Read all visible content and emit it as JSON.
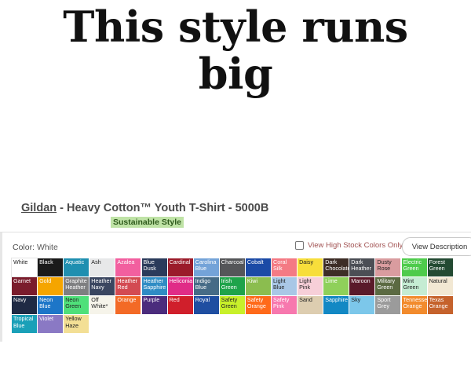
{
  "headline": {
    "line1": "This style runs",
    "line2": "big"
  },
  "product": {
    "brand": "Gildan",
    "separator": " - ",
    "title": "Heavy Cotton™ Youth T-Shirt - 5000B",
    "badge": "Sustainable Style"
  },
  "color_selector": {
    "label": "Color:",
    "selected": "White",
    "high_stock_label": "View High Stock Colors Only",
    "high_stock_checked": false,
    "view_description": "View Description"
  },
  "swatches": [
    [
      {
        "name": "White",
        "bg": "#ffffff",
        "fg": "#222222"
      },
      {
        "name": "Black",
        "bg": "#1a1a1a",
        "fg": "#ffffff"
      },
      {
        "name": "Aquatic",
        "bg": "#1f8fb0",
        "fg": "#ffffff"
      },
      {
        "name": "Ash",
        "bg": "#e7e8e9",
        "fg": "#222222"
      },
      {
        "name": "Azalea",
        "bg": "#f25f9f",
        "fg": "#ffffff"
      },
      {
        "name": "Blue Dusk",
        "bg": "#2b3b5b",
        "fg": "#ffffff"
      },
      {
        "name": "Cardinal",
        "bg": "#9b1b2a",
        "fg": "#ffffff"
      },
      {
        "name": "Carolina Blue",
        "bg": "#74a3d8",
        "fg": "#ffffff"
      },
      {
        "name": "Charcoal",
        "bg": "#555659",
        "fg": "#ffffff"
      },
      {
        "name": "Cobalt",
        "bg": "#1b4aa6",
        "fg": "#ffffff"
      },
      {
        "name": "Coral Silk",
        "bg": "#f47a84",
        "fg": "#ffffff"
      },
      {
        "name": "Daisy",
        "bg": "#f7de3b",
        "fg": "#222222"
      },
      {
        "name": "Dark Chocolate",
        "bg": "#3d2d26",
        "fg": "#ffffff"
      },
      {
        "name": "Dark Heather",
        "bg": "#4b4e55",
        "fg": "#ffffff"
      },
      {
        "name": "Dusty Rose",
        "bg": "#d99c9f",
        "fg": "#222222"
      },
      {
        "name": "Electric Green",
        "bg": "#4ecb4b",
        "fg": "#ffffff"
      },
      {
        "name": "Forest Green",
        "bg": "#234a32",
        "fg": "#ffffff"
      }
    ],
    [
      {
        "name": "Garnet",
        "bg": "#7a1c2c",
        "fg": "#ffffff"
      },
      {
        "name": "Gold",
        "bg": "#f5a500",
        "fg": "#ffffff"
      },
      {
        "name": "Graphite Heather",
        "bg": "#7e7f81",
        "fg": "#ffffff"
      },
      {
        "name": "Heather Navy",
        "bg": "#3a4660",
        "fg": "#ffffff"
      },
      {
        "name": "Heather Red",
        "bg": "#d34a52",
        "fg": "#ffffff"
      },
      {
        "name": "Heather Sapphire",
        "bg": "#2f8cc4",
        "fg": "#ffffff"
      },
      {
        "name": "Heliconia",
        "bg": "#e02c87",
        "fg": "#ffffff"
      },
      {
        "name": "Indigo Blue",
        "bg": "#466b86",
        "fg": "#ffffff"
      },
      {
        "name": "Irish Green",
        "bg": "#1fa34a",
        "fg": "#ffffff"
      },
      {
        "name": "Kiwi",
        "bg": "#8bbd4f",
        "fg": "#ffffff"
      },
      {
        "name": "Light Blue",
        "bg": "#a9c7e6",
        "fg": "#222222"
      },
      {
        "name": "Light Pink",
        "bg": "#f7cfd8",
        "fg": "#222222"
      },
      {
        "name": "Lime",
        "bg": "#8fd05a",
        "fg": "#ffffff"
      },
      {
        "name": "Maroon",
        "bg": "#5a1a2a",
        "fg": "#ffffff"
      },
      {
        "name": "Military Green",
        "bg": "#5b6a42",
        "fg": "#ffffff"
      },
      {
        "name": "Mint Green",
        "bg": "#c5ecd3",
        "fg": "#222222"
      },
      {
        "name": "Natural",
        "bg": "#f2e8d3",
        "fg": "#222222"
      }
    ],
    [
      {
        "name": "Navy",
        "bg": "#1f2a44",
        "fg": "#ffffff"
      },
      {
        "name": "Neon Blue",
        "bg": "#1d76c8",
        "fg": "#ffffff"
      },
      {
        "name": "Neon Green",
        "bg": "#4fe07a",
        "fg": "#222222"
      },
      {
        "name": "Off White*",
        "bg": "#f6f4ea",
        "fg": "#222222"
      },
      {
        "name": "Orange",
        "bg": "#f36a26",
        "fg": "#ffffff"
      },
      {
        "name": "Purple",
        "bg": "#4b2c7d",
        "fg": "#ffffff"
      },
      {
        "name": "Red",
        "bg": "#d01f2b",
        "fg": "#ffffff"
      },
      {
        "name": "Royal",
        "bg": "#1f4ea1",
        "fg": "#ffffff"
      },
      {
        "name": "Safety Green",
        "bg": "#c8f02a",
        "fg": "#222222"
      },
      {
        "name": "Safety Orange",
        "bg": "#ff6a1a",
        "fg": "#ffffff"
      },
      {
        "name": "Safety Pink",
        "bg": "#f778ae",
        "fg": "#ffffff"
      },
      {
        "name": "Sand",
        "bg": "#ddcdb0",
        "fg": "#222222"
      },
      {
        "name": "Sapphire",
        "bg": "#1288c4",
        "fg": "#ffffff"
      },
      {
        "name": "Sky",
        "bg": "#7cc7ea",
        "fg": "#222222"
      },
      {
        "name": "Sport Grey",
        "bg": "#9b9b9b",
        "fg": "#ffffff"
      },
      {
        "name": "Tennessee Orange",
        "bg": "#f28b2d",
        "fg": "#ffffff"
      },
      {
        "name": "Texas Orange",
        "bg": "#c5622c",
        "fg": "#ffffff"
      }
    ],
    [
      {
        "name": "Tropical Blue",
        "bg": "#1aa0b8",
        "fg": "#ffffff"
      },
      {
        "name": "Violet",
        "bg": "#8a79c4",
        "fg": "#ffffff"
      },
      {
        "name": "Yellow Haze",
        "bg": "#f3df95",
        "fg": "#222222"
      }
    ]
  ]
}
